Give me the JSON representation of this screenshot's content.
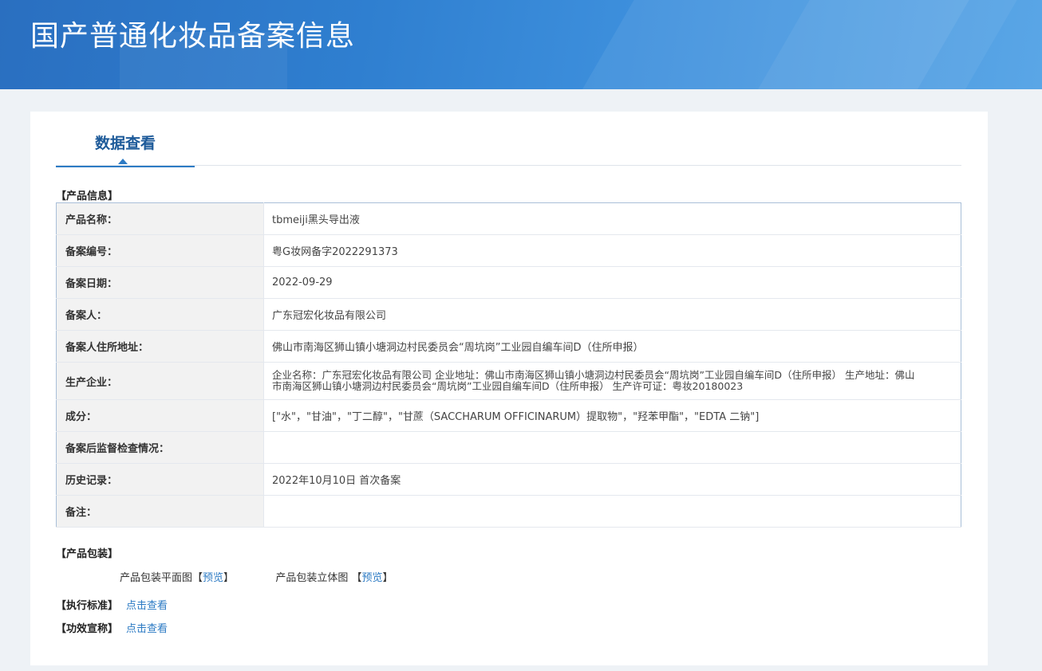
{
  "header": {
    "title": "国产普通化妆品备案信息"
  },
  "tabs": [
    {
      "label": "数据查看"
    }
  ],
  "product_info": {
    "section_title": "【产品信息】",
    "rows": [
      {
        "label": "产品名称：",
        "value": "tbmeiji黑头导出液"
      },
      {
        "label": "备案编号：",
        "value": "粤G妆网备字2022291373"
      },
      {
        "label": "备案日期：",
        "value": "2022-09-29"
      },
      {
        "label": "备案人：",
        "value": "广东冠宏化妆品有限公司"
      },
      {
        "label": "备案人住所地址：",
        "value": "佛山市南海区狮山镇小塘洞边村民委员会“周坑岗”工业园自编车间D（住所申报）"
      },
      {
        "label": "生产企业：",
        "value": "企业名称：广东冠宏化妆品有限公司 企业地址：佛山市南海区狮山镇小塘洞边村民委员会“周坑岗”工业园自编车间D（住所申报） 生产地址：佛山市南海区狮山镇小塘洞边村民委员会“周坑岗”工业园自编车间D（住所申报） 生产许可证：粤妆20180023"
      },
      {
        "label": "成分：",
        "value": "[\"水\"，\"甘油\"，\"丁二醇\"，\"甘蔗（SACCHARUM OFFICINARUM）提取物\"，\"羟苯甲酯\"，\"EDTA 二钠\"]"
      },
      {
        "label": "备案后监督检查情况：",
        "value": ""
      },
      {
        "label": "历史记录：",
        "value": "2022年10月10日 首次备案"
      },
      {
        "label": "备注：",
        "value": ""
      }
    ]
  },
  "packaging": {
    "section_title": "【产品包装】",
    "flat_label": "产品包装平面图",
    "threed_label": "产品包装立体图",
    "bracket_open": "【",
    "bracket_close": "】",
    "preview_link": "预览"
  },
  "standard": {
    "section_title": "【执行标准】",
    "link": "点击查看"
  },
  "efficacy": {
    "section_title": "【功效宣称】",
    "link": "点击查看"
  }
}
